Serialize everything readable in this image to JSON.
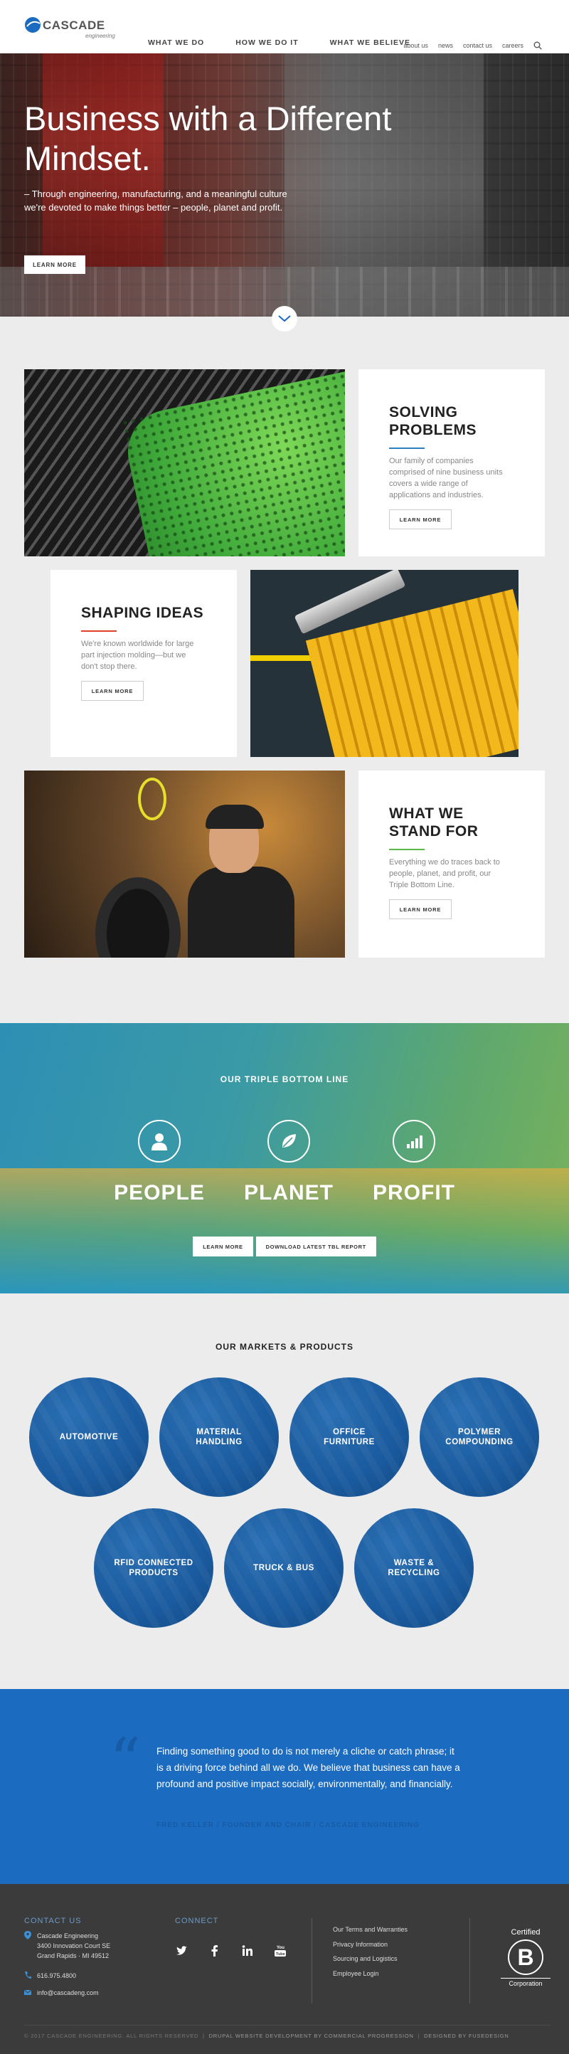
{
  "header": {
    "logo_name": "CASCADE",
    "logo_sub": "engineering",
    "main_nav": [
      "WHAT WE DO",
      "HOW WE DO IT",
      "WHAT WE BELIEVE"
    ],
    "util_nav": [
      "about us",
      "news",
      "contact us",
      "careers"
    ]
  },
  "hero": {
    "title": "Business with a Different Mindset.",
    "text": "– Through engineering, manufacturing, and a meaningful culture we're devoted to make things better – people, planet and profit.",
    "button": "LEARN MORE"
  },
  "cards": [
    {
      "title": "SOLVING PROBLEMS",
      "text": "Our family of companies comprised of nine business units covers a wide range of applications and industries.",
      "button": "LEARN MORE",
      "rule_color": "#2e7fc0"
    },
    {
      "title": "SHAPING IDEAS",
      "text": "We're known worldwide for large part injection molding—but we don't stop there.",
      "button": "LEARN MORE",
      "rule_color": "#e0402a"
    },
    {
      "title": "WHAT WE STAND FOR",
      "text": "Everything we do traces back to people, planet, and profit, our Triple Bottom Line.",
      "button": "LEARN MORE",
      "rule_color": "#5cb847"
    }
  ],
  "tbl": {
    "title": "OUR TRIPLE BOTTOM LINE",
    "pillars": [
      {
        "word": "PEOPLE",
        "icon": "person-icon"
      },
      {
        "word": "PLANET",
        "icon": "leaf-icon"
      },
      {
        "word": "PROFIT",
        "icon": "bar-chart-icon"
      }
    ],
    "buttons": [
      "LEARN MORE",
      "DOWNLOAD LATEST TBL REPORT"
    ]
  },
  "markets": {
    "title": "OUR MARKETS & PRODUCTS",
    "items": [
      "AUTOMOTIVE",
      "MATERIAL HANDLING",
      "OFFICE FURNITURE",
      "POLYMER COMPOUNDING",
      "RFID CONNECTED PRODUCTS",
      "TRUCK & BUS",
      "WASTE & RECYCLING"
    ]
  },
  "quote": {
    "text": "Finding something good to do is not merely a cliche or catch phrase; it is a driving force behind all we do. We believe that business can have a profound and positive impact socially, environmentally, and financially.",
    "author": "FRED KELLER / FOUNDER AND CHAIR / CASCADE ENGINEERING"
  },
  "footer": {
    "contact_heading": "CONTACT US",
    "address": [
      "Cascade Engineering",
      "3400 Innovation Court SE",
      "Grand Rapids · MI 49512"
    ],
    "phone": "616.975.4800",
    "email": "info@cascadeng.com",
    "connect_heading": "CONNECT",
    "social": [
      "twitter-icon",
      "facebook-icon",
      "linkedin-icon",
      "youtube-icon"
    ],
    "links": [
      "Our Terms and Warranties",
      "Privacy Information",
      "Sourcing and Logistics",
      "Employee Login"
    ],
    "bcorp_top": "Certified",
    "bcorp_letter": "B",
    "bcorp_bottom": "Corporation",
    "copyright": "© 2017 CASCADE ENGINEERING. ALL RIGHTS RESERVED",
    "dev": "DRUPAL WEBSITE DEVELOPMENT BY COMMERCIAL PROGRESSION",
    "design": "DESIGNED BY FUSEDESIGN"
  },
  "colors": {
    "accent_blue": "#1b6bc1",
    "market_blue": "#1a5a9e",
    "footer_bg": "#3b3b3b"
  }
}
